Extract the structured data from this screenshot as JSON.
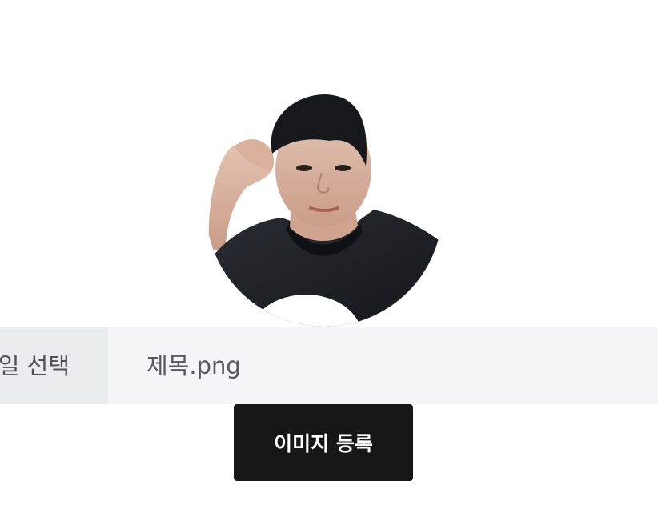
{
  "upload": {
    "file_select_label": "일 선택",
    "file_name": "제목.png"
  },
  "actions": {
    "register_label": "이미지 등록"
  },
  "colors": {
    "file_button_bg": "#ebecee",
    "file_name_bg": "#f5f5f8",
    "register_button_bg": "#171717",
    "register_button_text": "#ffffff"
  }
}
